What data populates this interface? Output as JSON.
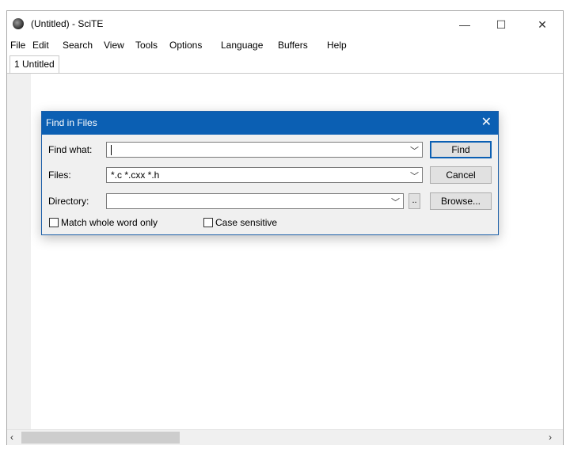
{
  "window": {
    "title": "(Untitled) - SciTE"
  },
  "menu": [
    "File",
    "Edit",
    "Search",
    "View",
    "Tools",
    "Options",
    "Language",
    "Buffers",
    "Help"
  ],
  "tabs": [
    {
      "label": "1 Untitled"
    }
  ],
  "dialog": {
    "title": "Find in Files",
    "find_what": {
      "label": "Find what:",
      "value": ""
    },
    "files": {
      "label": "Files:",
      "value": "*.c *.cxx *.h"
    },
    "directory": {
      "label": "Directory:",
      "value": "",
      "dots_label": ".."
    },
    "buttons": {
      "find": "Find",
      "cancel": "Cancel",
      "browse": "Browse..."
    },
    "options": {
      "match_whole_word": {
        "label": "Match whole word only",
        "checked": false
      },
      "case_sensitive": {
        "label": "Case sensitive",
        "checked": false
      }
    }
  },
  "icons": {
    "minimize": "minimize-icon",
    "maximize": "maximize-icon",
    "close": "close-icon",
    "dropdown": "chevron-down-icon",
    "scroll_left": "chevron-left-icon",
    "scroll_right": "chevron-right-icon"
  },
  "colors": {
    "dialog_title_bg": "#0b5fb3",
    "margin_bg": "#f0f0f0"
  }
}
